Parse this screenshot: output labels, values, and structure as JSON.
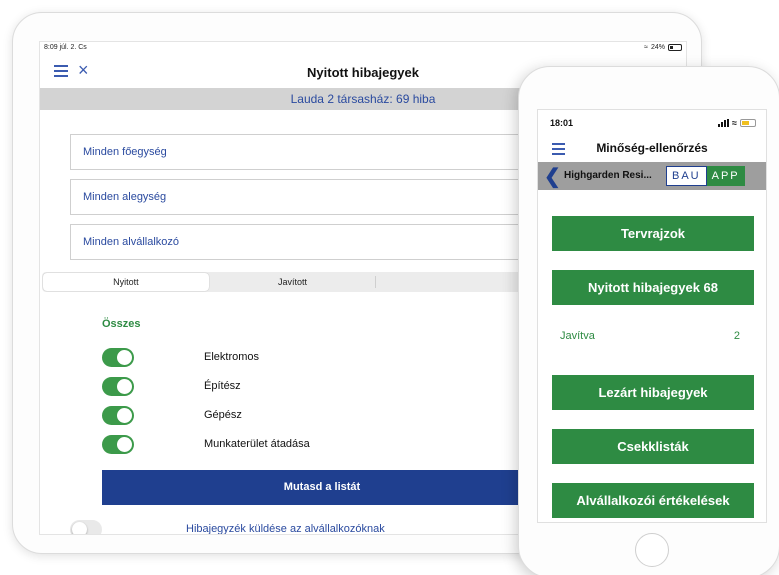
{
  "tablet": {
    "status": {
      "time": "8:09  júl. 2. Cs",
      "battery": "24%"
    },
    "nav": {
      "title": "Nyitott hibajegyek"
    },
    "banner": "Lauda 2 társasház: 69 hiba",
    "selects": [
      "Minden főegység",
      "Minden alegység",
      "Minden alvállalkozó"
    ],
    "segments": [
      "Nyitott",
      "Javított",
      ""
    ],
    "filter": {
      "all_label": "Összes",
      "items": [
        {
          "label": "Elektromos",
          "on": true
        },
        {
          "label": "Építész",
          "on": true
        },
        {
          "label": "Gépész",
          "on": true
        },
        {
          "label": "Munkaterület átadása",
          "on": true
        }
      ]
    },
    "primary_button": "Mutasd a listát",
    "send_toggle": {
      "label": "Hibajegyzék küldése az alvállalkozóknak",
      "on": false
    }
  },
  "phone": {
    "status": {
      "time": "18:01"
    },
    "nav": {
      "title": "Minőség-ellenőrzés"
    },
    "project": {
      "name": "Highgarden Resi...",
      "logo_left": "BAU",
      "logo_right": "APP"
    },
    "buttons": {
      "plans": "Tervrajzok",
      "open_tickets": "Nyitott hibajegyek  68",
      "closed_tickets": "Lezárt hibajegyek",
      "checklists": "Csekklisták",
      "ratings": "Alvállalkozói értékelések"
    },
    "fixed": {
      "label": "Javítva",
      "count": "2"
    }
  },
  "colors": {
    "green": "#2e8b43",
    "blue": "#1f3f8f",
    "link": "#2a4a9f"
  }
}
